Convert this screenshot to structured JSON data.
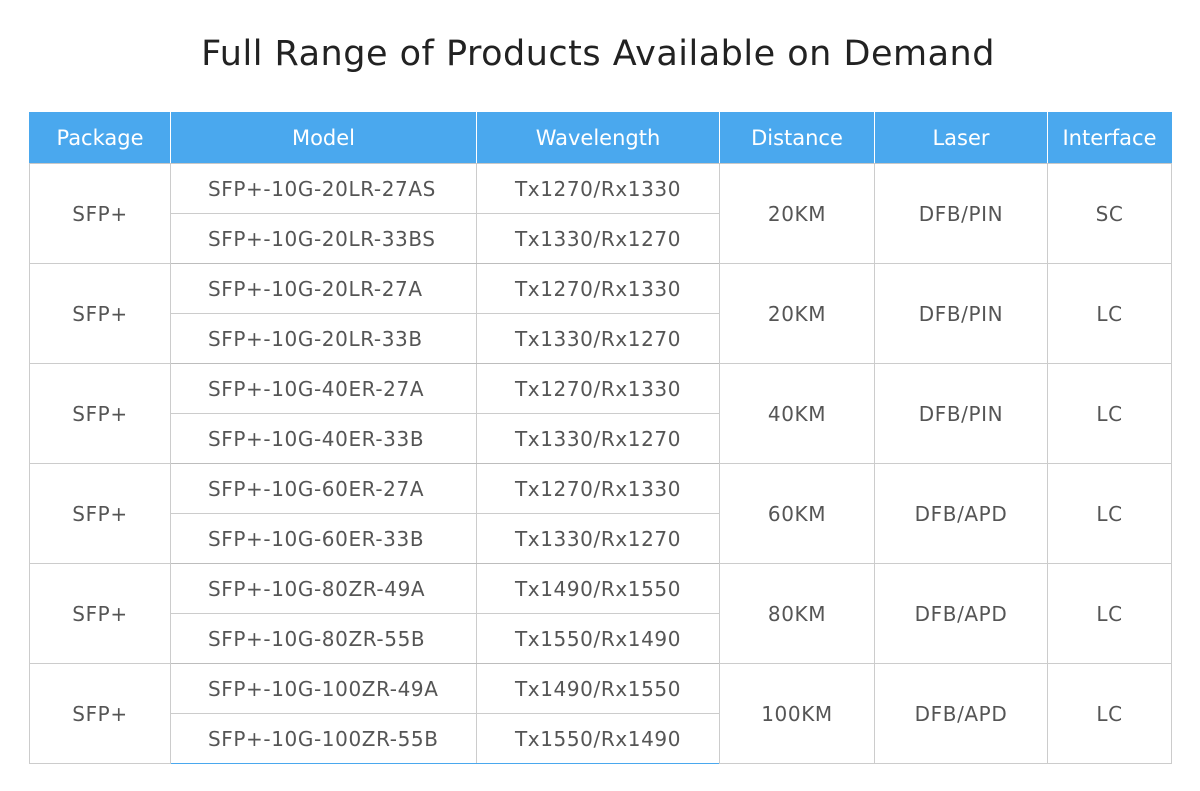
{
  "title": "Full Range of Products Available on Demand",
  "columns": [
    "Package",
    "Model",
    "Wavelength",
    "Distance",
    "Laser",
    "Interface"
  ],
  "groups": [
    {
      "package": "SFP+",
      "distance": "20KM",
      "laser": "DFB/PIN",
      "interface": "SC",
      "rows": [
        {
          "model": "SFP+-10G-20LR-27AS",
          "wavelength": "Tx1270/Rx1330"
        },
        {
          "model": "SFP+-10G-20LR-33BS",
          "wavelength": "Tx1330/Rx1270"
        }
      ]
    },
    {
      "package": "SFP+",
      "distance": "20KM",
      "laser": "DFB/PIN",
      "interface": "LC",
      "rows": [
        {
          "model": "SFP+-10G-20LR-27A",
          "wavelength": "Tx1270/Rx1330"
        },
        {
          "model": "SFP+-10G-20LR-33B",
          "wavelength": "Tx1330/Rx1270"
        }
      ]
    },
    {
      "package": "SFP+",
      "distance": "40KM",
      "laser": "DFB/PIN",
      "interface": "LC",
      "rows": [
        {
          "model": "SFP+-10G-40ER-27A",
          "wavelength": "Tx1270/Rx1330"
        },
        {
          "model": "SFP+-10G-40ER-33B",
          "wavelength": "Tx1330/Rx1270"
        }
      ]
    },
    {
      "package": "SFP+",
      "distance": "60KM",
      "laser": "DFB/APD",
      "interface": "LC",
      "rows": [
        {
          "model": "SFP+-10G-60ER-27A",
          "wavelength": "Tx1270/Rx1330"
        },
        {
          "model": "SFP+-10G-60ER-33B",
          "wavelength": "Tx1330/Rx1270"
        }
      ]
    },
    {
      "package": "SFP+",
      "distance": "80KM",
      "laser": "DFB/APD",
      "interface": "LC",
      "rows": [
        {
          "model": "SFP+-10G-80ZR-49A",
          "wavelength": "Tx1490/Rx1550"
        },
        {
          "model": "SFP+-10G-80ZR-55B",
          "wavelength": "Tx1550/Rx1490"
        }
      ]
    },
    {
      "package": "SFP+",
      "distance": "100KM",
      "laser": "DFB/APD",
      "interface": "LC",
      "rows": [
        {
          "model": "SFP+-10G-100ZR-49A",
          "wavelength": "Tx1490/Rx1550"
        },
        {
          "model": "SFP+-10G-100ZR-55B",
          "wavelength": "Tx1550/Rx1490"
        }
      ]
    }
  ],
  "colors": {
    "header_bg": "#4aa8ee",
    "header_text": "#ffffff",
    "cell_text": "#555555",
    "title_text": "#222222",
    "grid_line": "#cccccc"
  }
}
